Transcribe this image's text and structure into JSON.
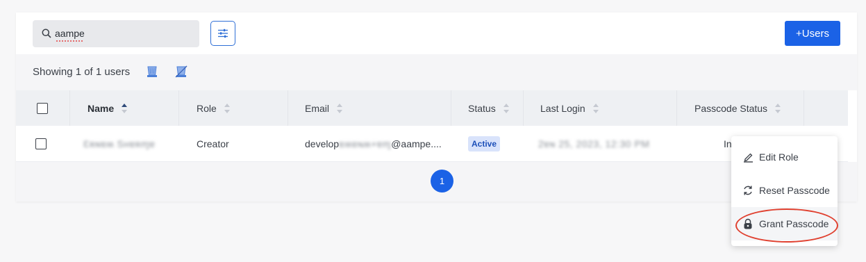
{
  "search": {
    "value": "aampe",
    "icon": "search-icon"
  },
  "toolbar": {
    "add_users_label": "+Users",
    "filter_icon": "sliders-icon"
  },
  "summary": {
    "text": "Showing 1 of 1 users",
    "icons": [
      "column-toggle-icon",
      "column-hide-icon"
    ]
  },
  "table": {
    "columns": [
      "Name",
      "Role",
      "Email",
      "Status",
      "Last Login",
      "Passcode Status"
    ],
    "rows": [
      {
        "name": "Ɛʀɴɐʍ Sʜɐʀɱɐ",
        "role": "Creator",
        "email_prefix": "develop",
        "email_hidden": "ɐʍɐɴʍ+ɐɱ",
        "email_suffix": "@aampe....",
        "status": "Active",
        "last_login": "2ɐɴ 25, 2023, 12:30 PM",
        "passcode_status": "In"
      }
    ]
  },
  "pagination": {
    "current_page": "1"
  },
  "context_menu": {
    "items": [
      {
        "label": "Edit Role",
        "icon": "pencil-icon"
      },
      {
        "label": "Reset Passcode",
        "icon": "refresh-icon"
      },
      {
        "label": "Grant Passcode",
        "icon": "lock-icon"
      }
    ]
  },
  "colors": {
    "accent": "#1b62e6",
    "badge_bg": "#d9e3fb",
    "highlight": "#e0402f"
  }
}
